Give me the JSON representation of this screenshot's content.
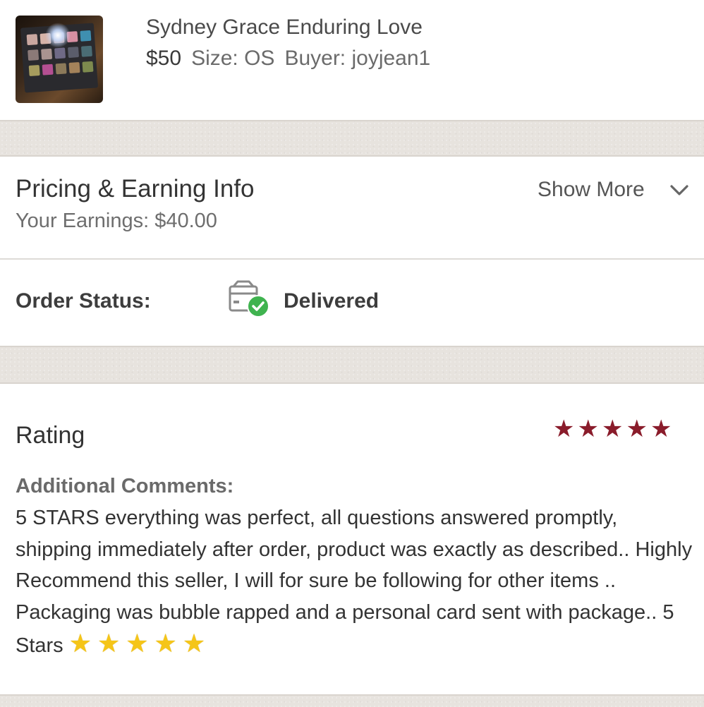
{
  "product": {
    "title": "Sydney Grace Enduring Love",
    "price": "$50",
    "size": "Size: OS",
    "buyer": "Buyer: joyjean1",
    "thumbnail": "eyeshadow-palette-photo"
  },
  "pricing": {
    "title": "Pricing & Earning Info",
    "earnings": "Your Earnings: $40.00",
    "show_more": "Show More",
    "show_more_icon": "chevron-down-icon"
  },
  "order_status": {
    "label": "Order Status:",
    "value": "Delivered",
    "icon": "package-delivered-icon",
    "icon_color": "#3fb34f"
  },
  "rating": {
    "title": "Rating",
    "stars": 5,
    "max_stars": 5,
    "star_color": "#8a1c2b",
    "comments_label": "Additional Comments:",
    "comments_text": "5 STARS everything was perfect, all questions answered promptly, shipping immediately after order, product was exactly as described.. Highly Recommend this seller, I will for sure be following for other items .. Packaging was bubble rapped and a personal card sent with package.. 5 Stars",
    "comment_emoji_stars": 5,
    "emoji_star_color": "#f5c518"
  }
}
